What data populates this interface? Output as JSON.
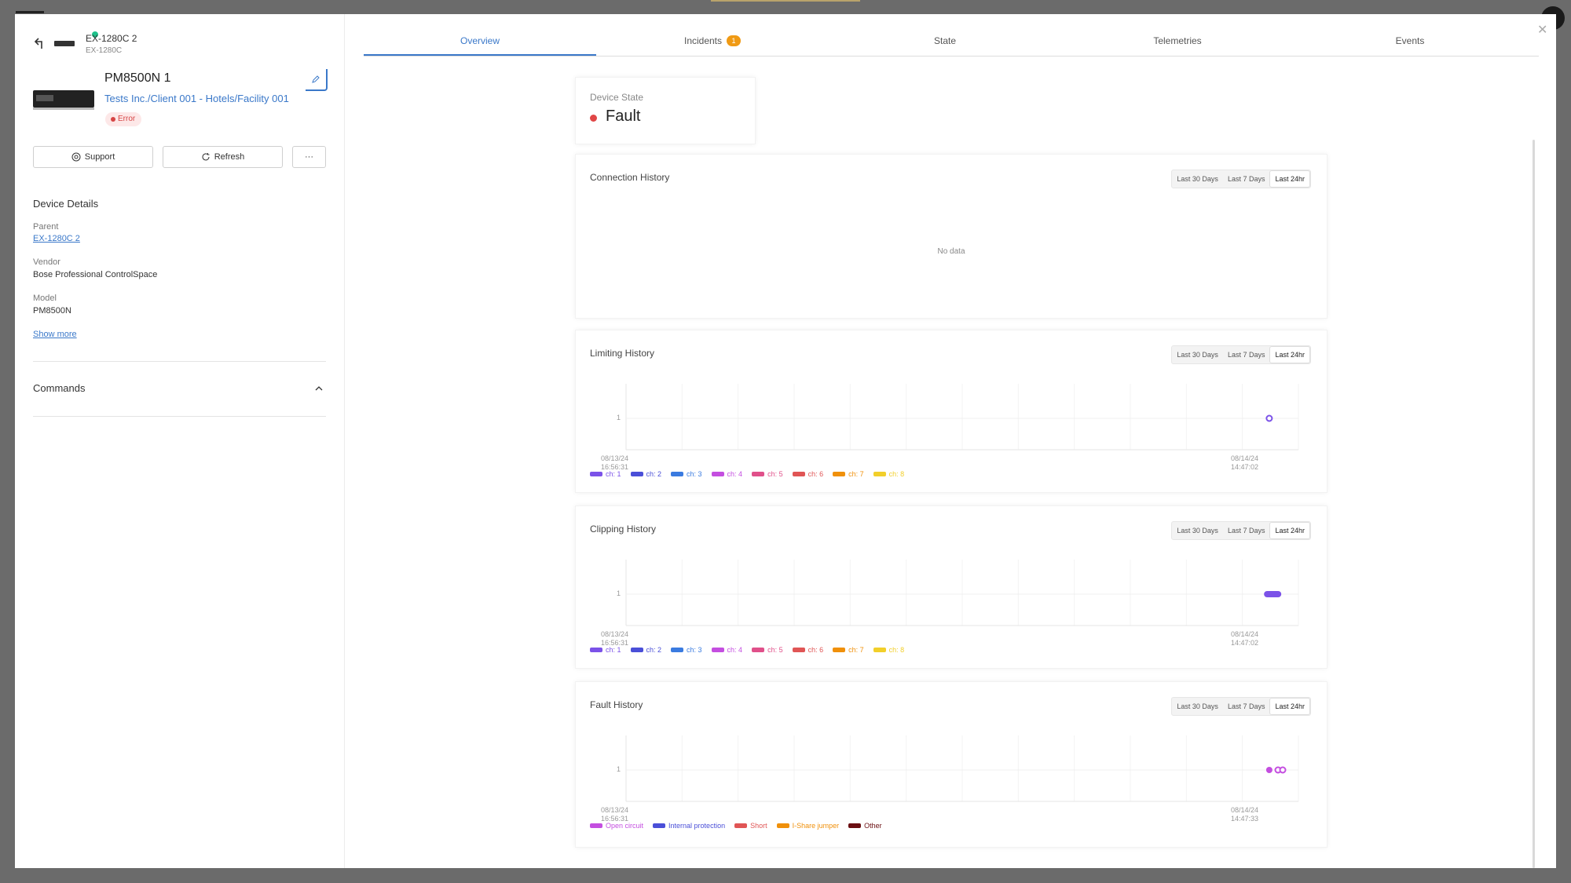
{
  "header": {
    "parent_name": "EX-1280C 2",
    "parent_model": "EX-1280C"
  },
  "device": {
    "name": "PM8500N 1",
    "path": "Tests Inc./Client 001 - Hotels/Facility 001",
    "status": "Error"
  },
  "actions": {
    "support": "Support",
    "refresh": "Refresh",
    "more": "···"
  },
  "details": {
    "title": "Device Details",
    "parent_label": "Parent",
    "parent_value": "EX-1280C 2",
    "vendor_label": "Vendor",
    "vendor_value": "Bose Professional ControlSpace",
    "model_label": "Model",
    "model_value": "PM8500N",
    "show_more": "Show more"
  },
  "commands": {
    "title": "Commands"
  },
  "tabs": [
    {
      "label": "Overview",
      "active": true
    },
    {
      "label": "Incidents",
      "badge": "1"
    },
    {
      "label": "State"
    },
    {
      "label": "Telemetries"
    },
    {
      "label": "Events"
    }
  ],
  "device_state": {
    "label": "Device State",
    "value": "Fault",
    "color": "#e04646"
  },
  "ranges": [
    "Last 30 Days",
    "Last 7 Days",
    "Last 24hr"
  ],
  "active_range": "Last 24hr",
  "connection": {
    "title": "Connection History",
    "empty": "No data"
  },
  "channel_colors": [
    "#7b52e8",
    "#4a4fd8",
    "#3a7be0",
    "#c44ee0",
    "#e0508a",
    "#e05555",
    "#f0900a",
    "#f2cf2a"
  ],
  "chart_data": [
    {
      "type": "scatter",
      "title": "Limiting History",
      "ytick": "1",
      "x_start": "08/13/24\n16:56:31",
      "x_end": "08/14/24\n14:47:02",
      "series": [
        {
          "name": "ch: 1",
          "points": []
        },
        {
          "name": "ch: 2",
          "points": []
        },
        {
          "name": "ch: 3",
          "points": []
        },
        {
          "name": "ch: 4",
          "points": []
        },
        {
          "name": "ch: 5",
          "points": []
        },
        {
          "name": "ch: 6",
          "points": []
        },
        {
          "name": "ch: 7",
          "points": []
        },
        {
          "name": "ch: 8",
          "points": []
        }
      ],
      "marks": [
        {
          "series": 0,
          "x": 0.98,
          "y": 1,
          "kind": "ring"
        }
      ]
    },
    {
      "type": "scatter",
      "title": "Clipping History",
      "ytick": "1",
      "x_start": "08/13/24\n16:56:31",
      "x_end": "08/14/24\n14:47:02",
      "series": [
        {
          "name": "ch: 1"
        },
        {
          "name": "ch: 2"
        },
        {
          "name": "ch: 3"
        },
        {
          "name": "ch: 4"
        },
        {
          "name": "ch: 5"
        },
        {
          "name": "ch: 6"
        },
        {
          "name": "ch: 7"
        },
        {
          "name": "ch: 8"
        }
      ],
      "marks": [
        {
          "series": 0,
          "x": 0.985,
          "y": 1,
          "kind": "pill"
        }
      ]
    },
    {
      "type": "scatter",
      "title": "Fault History",
      "ytick": "1",
      "x_start": "08/13/24\n16:56:31",
      "x_end": "08/14/24\n14:47:33",
      "series": [
        {
          "name": "Open circuit",
          "color": "#c44ee0"
        },
        {
          "name": "Internal protection",
          "color": "#4a4fd8"
        },
        {
          "name": "Short",
          "color": "#e05555"
        },
        {
          "name": "I-Share jumper",
          "color": "#f0900a"
        },
        {
          "name": "Other",
          "color": "#6b0f12"
        }
      ],
      "marks": [
        {
          "series": 0,
          "x": 0.98,
          "y": 1,
          "kind": "dot"
        },
        {
          "series": 0,
          "x": 0.993,
          "y": 1,
          "kind": "ring"
        },
        {
          "series": 0,
          "x": 1.0,
          "y": 1,
          "kind": "ring"
        }
      ]
    }
  ]
}
